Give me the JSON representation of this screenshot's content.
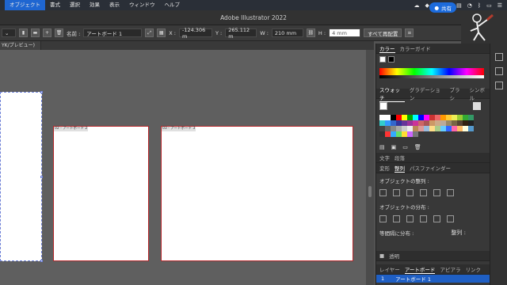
{
  "menubar": {
    "items": [
      "オブジェクト",
      "書式",
      "選択",
      "効果",
      "表示",
      "ウィンドウ",
      "ヘルプ"
    ],
    "active_index": 0
  },
  "titlebar": {
    "title": "Adobe Illustrator 2022",
    "share_label": "共有"
  },
  "controlbar": {
    "name_label": "名前 :",
    "name_value": "アートボード 1",
    "x_label": "X :",
    "x_value": "-124.306 m",
    "y_label": "Y :",
    "y_value": "265.112 m",
    "w_label": "W :",
    "w_value": "210 mm",
    "h_label": "H :",
    "h_value": "4 mm",
    "arrange_all_label": "すべて再配置"
  },
  "document": {
    "tab_label": "YK/プレビュー)"
  },
  "artboards": [
    {
      "label": "02 - アートボード 2"
    },
    {
      "label": "03 - アートボード 3"
    }
  ],
  "panels": {
    "color_tabs": [
      "カラー",
      "カラーガイド"
    ],
    "swatch_tabs": [
      "スウォッチ",
      "グラデーション",
      "ブラシ",
      "シンボル"
    ],
    "type_tabs": [
      "文字",
      "段落"
    ],
    "align_tabs": [
      "変形",
      "整列",
      "パスファインダー"
    ],
    "align_objects_label": "オブジェクトの整列 :",
    "distribute_objects_label": "オブジェクトの分布 :",
    "distribute_spacing_label": "等間隔に分布 :",
    "align_to_label": "整列 :",
    "transparency_label": "透明",
    "layers_tabs": [
      "レイヤー",
      "アートボード",
      "アピアラ",
      "リンク"
    ],
    "artboard_list_first": "アートボード 1",
    "artboard_list_number": "1"
  },
  "colors": {
    "accent": "#1f66d1",
    "artboard_border": "#b4262a",
    "canvas": "#5f5f5f"
  }
}
